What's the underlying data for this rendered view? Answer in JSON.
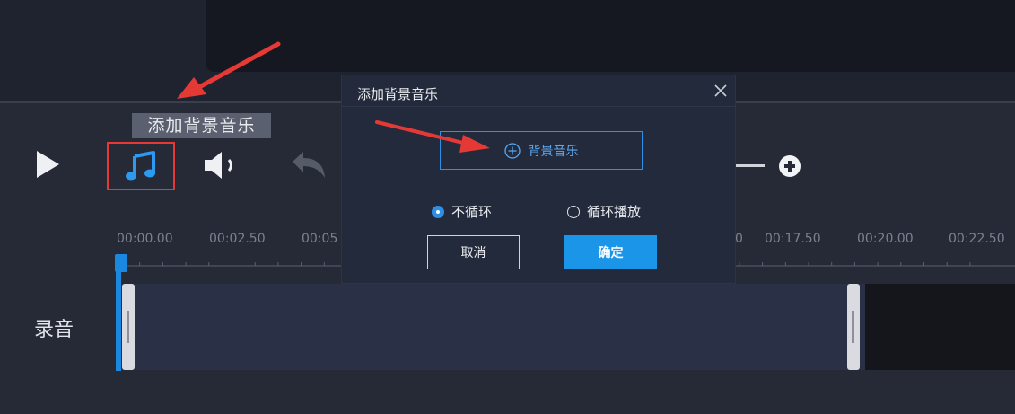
{
  "tooltip": {
    "text": "添加背景音乐"
  },
  "toolbar": {
    "play_icon": "play-icon",
    "music_icon": "music-note-icon",
    "volume_icon": "volume-icon",
    "undo_icon": "undo-icon",
    "zoom_in_icon": "plus-circle-icon"
  },
  "timeline": {
    "ticks": [
      "00:00.00",
      "00:02.50",
      "00:05",
      "0",
      "00:17.50",
      "00:20.00",
      "00:22.50"
    ]
  },
  "track": {
    "label": "录音"
  },
  "dialog": {
    "title": "添加背景音乐",
    "bgm_button_label": "背景音乐",
    "radio_no_loop": "不循环",
    "radio_loop": "循环播放",
    "cancel_label": "取消",
    "ok_label": "确定"
  },
  "colors": {
    "accent": "#1a95e8",
    "highlight_box": "#e53935",
    "background": "#252a36"
  }
}
